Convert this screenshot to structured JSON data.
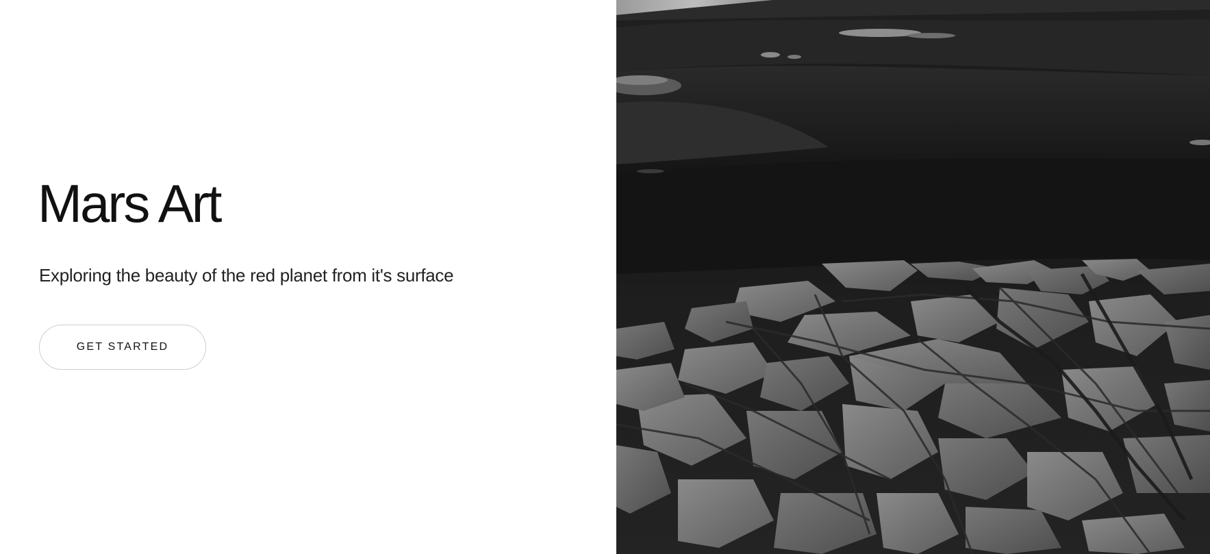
{
  "hero": {
    "title": "Mars Art",
    "subtitle": "Exploring the beauty of the red planet from it's surface",
    "cta_label": "GET STARTED"
  },
  "image": {
    "subject": "black-and-white Mars surface photograph with cracked rock slabs"
  }
}
